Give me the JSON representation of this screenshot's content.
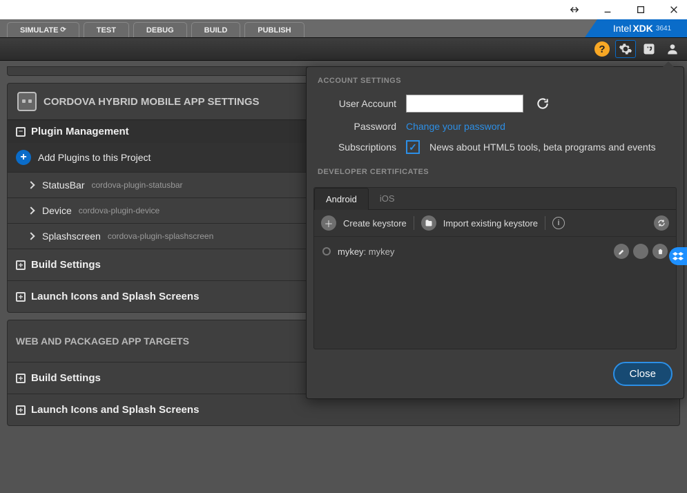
{
  "window": {},
  "tabs": {
    "simulate": "SIMULATE",
    "test": "TEST",
    "debug": "DEBUG",
    "build": "BUILD",
    "publish": "PUBLISH"
  },
  "brand": {
    "prefix": "Intel",
    "name": "XDK",
    "version": "3641"
  },
  "main": {
    "cordova_title": "CORDOVA HYBRID MOBILE APP SETTINGS",
    "plugin_mgmt": "Plugin Management",
    "add_plugins": "Add Plugins to this Project",
    "plugins": [
      {
        "name": "StatusBar",
        "id": "cordova-plugin-statusbar"
      },
      {
        "name": "Device",
        "id": "cordova-plugin-device"
      },
      {
        "name": "Splashscreen",
        "id": "cordova-plugin-splashscreen"
      }
    ],
    "build_settings": "Build Settings",
    "launch_icons": "Launch Icons and Splash Screens",
    "web_targets": "WEB AND PACKAGED APP TARGETS"
  },
  "popup": {
    "account_title": "ACCOUNT SETTINGS",
    "user_label": "User Account",
    "user_value": "",
    "password_label": "Password",
    "password_link": "Change your password",
    "subs_label": "Subscriptions",
    "subs_text": "News about HTML5 tools, beta programs and events",
    "subs_checked": true,
    "certs_title": "DEVELOPER CERTIFICATES",
    "tab_android": "Android",
    "tab_ios": "iOS",
    "create_keystore": "Create keystore",
    "import_keystore": "Import existing keystore",
    "key_alias": "mykey",
    "key_name": "mykey",
    "close": "Close"
  }
}
